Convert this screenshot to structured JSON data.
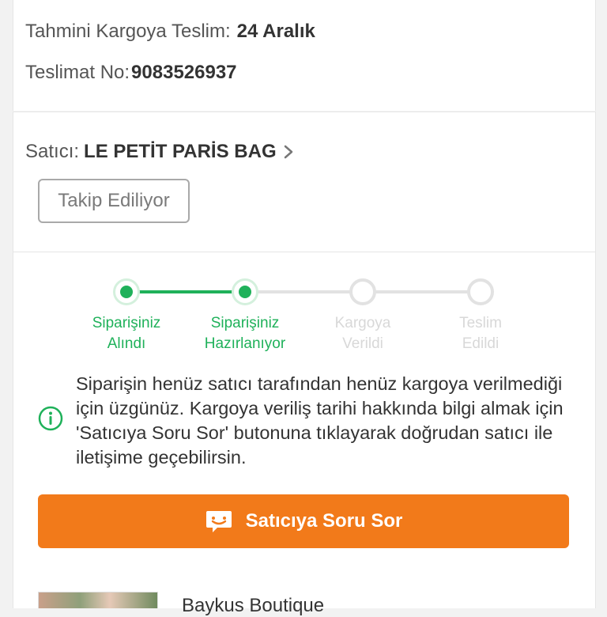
{
  "delivery": {
    "estimate_label": "Tahmini Kargoya Teslim:",
    "estimate_value": "24 Aralık",
    "number_label": "Teslimat No:",
    "number_value": "9083526937"
  },
  "seller": {
    "label": "Satıcı:",
    "name": "LE PETİT PARİS BAG",
    "follow_label": "Takip Ediliyor"
  },
  "stepper": {
    "steps": [
      {
        "line1": "Siparişiniz",
        "line2": "Alındı",
        "state": "done"
      },
      {
        "line1": "Siparişiniz",
        "line2": "Hazırlanıyor",
        "state": "done"
      },
      {
        "line1": "Kargoya",
        "line2": "Verildi",
        "state": "todo"
      },
      {
        "line1": "Teslim",
        "line2": "Edildi",
        "state": "todo"
      }
    ]
  },
  "notice": {
    "icon": "info-icon",
    "text": "Siparişin henüz satıcı tarafından henüz kargoya verilmediği için üzgünüz. Kargoya veriliş tarihi hakkında bilgi almak için 'Satıcıya Soru Sor' butonuna tıklayarak doğrudan satıcı ile iletişime geçebilirsin."
  },
  "ask_button": {
    "label": "Satıcıya Soru Sor",
    "icon": "chat-icon"
  },
  "product": {
    "store_name": "Baykus Boutique"
  },
  "colors": {
    "accent_green": "#1fb15a",
    "cta_orange": "#f27a1a",
    "inactive": "#e2e2e2"
  }
}
